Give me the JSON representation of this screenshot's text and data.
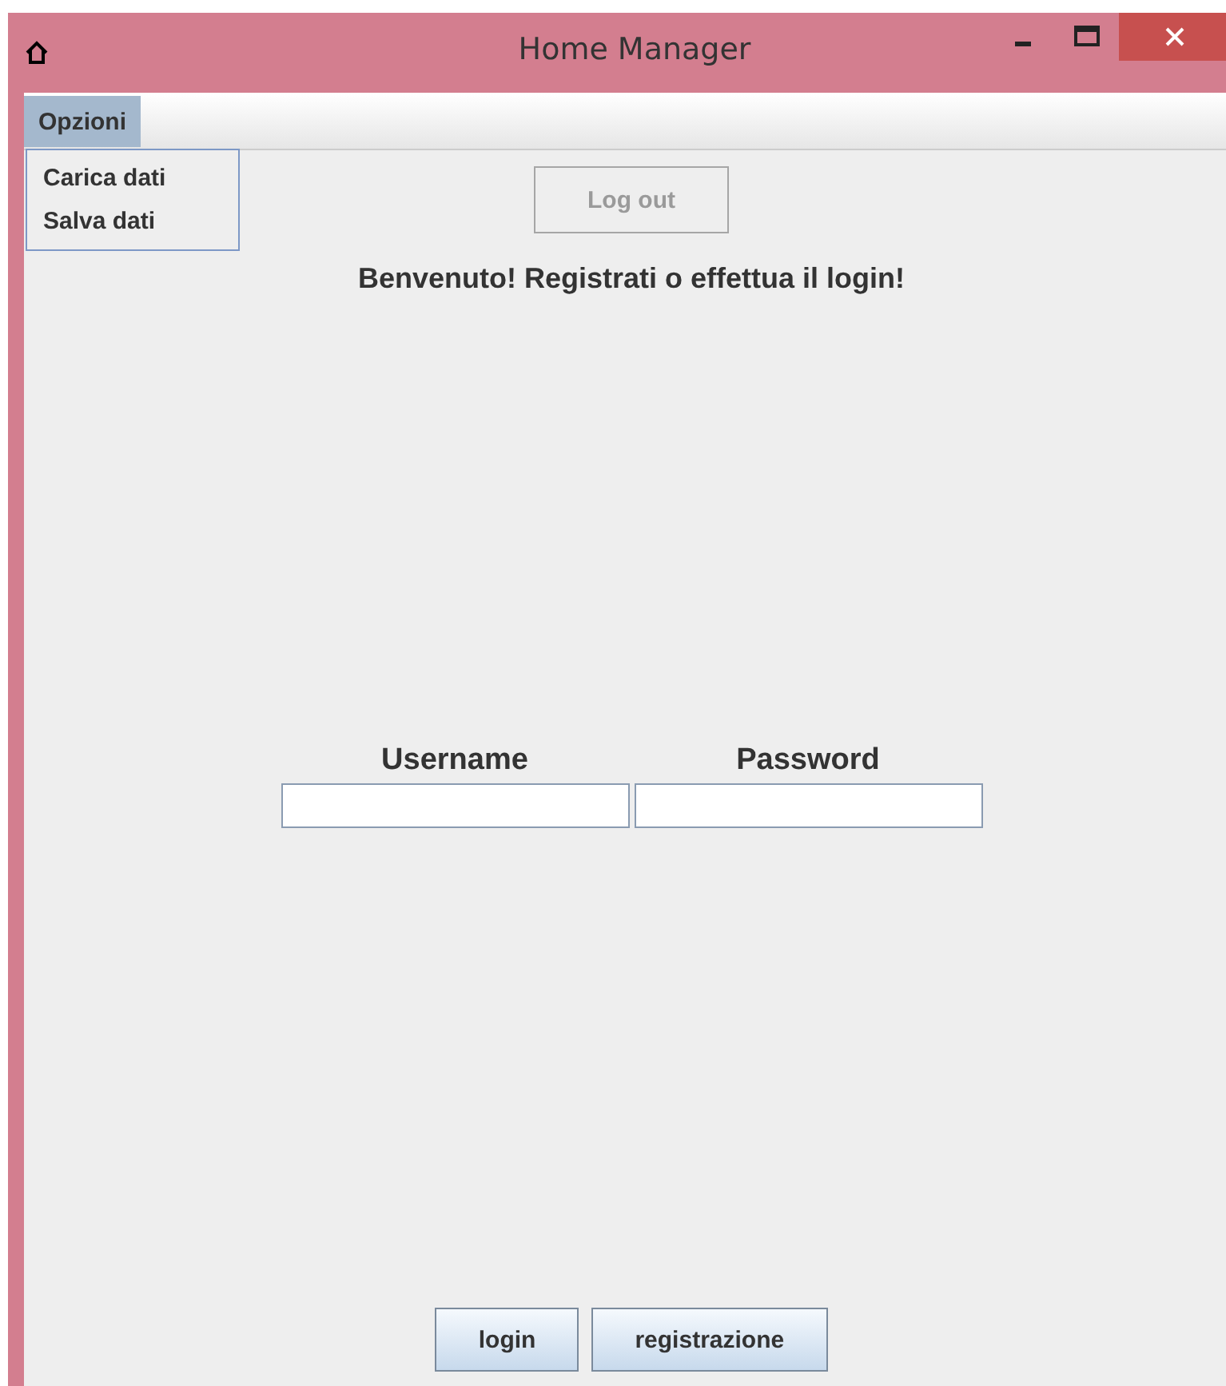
{
  "window": {
    "title": "Home Manager"
  },
  "menu_bar": [
    {
      "label": "Opzioni",
      "selected": true,
      "items": [
        {
          "label": "Carica dati"
        },
        {
          "label": "Salva dati"
        }
      ]
    }
  ],
  "logout_button": {
    "label": "Log out",
    "disabled": true
  },
  "welcome": "Benvenuto! Registrati o effettua il login!",
  "fields": [
    {
      "label": "Username"
    },
    {
      "label": "Password"
    }
  ],
  "buttons": [
    {
      "label": "login"
    },
    {
      "label": "registrazione"
    }
  ]
}
